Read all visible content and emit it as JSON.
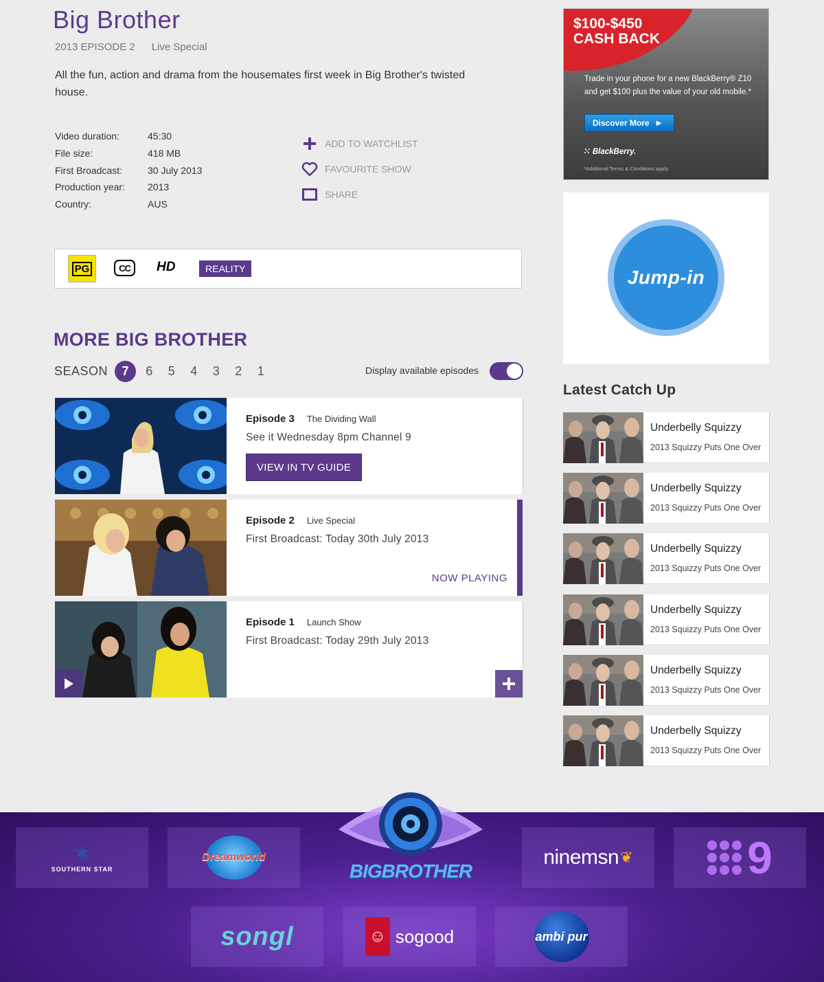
{
  "show": {
    "title": "Big Brother",
    "episode_label": "2013 EPISODE 2",
    "episode_type": "Live Special",
    "description": "All the fun, action and drama from the housemates first week in Big Brother's twisted house."
  },
  "details": [
    {
      "label": "Video duration:",
      "value": "45:30"
    },
    {
      "label": "File size:",
      "value": "418 MB"
    },
    {
      "label": "First Broadcast:",
      "value": "30 July 2013"
    },
    {
      "label": "Production year:",
      "value": "2013"
    },
    {
      "label": "Country:",
      "value": "AUS"
    }
  ],
  "actions": {
    "watchlist": "ADD TO WATCHLIST",
    "favourite": "FAVOURITE SHOW",
    "share": "SHARE"
  },
  "badges": {
    "rating": "PG",
    "cc": "CC",
    "hd": "HD",
    "genre": "REALITY"
  },
  "more": {
    "title": "MORE BIG BROTHER",
    "season_label": "SEASON",
    "seasons": [
      "7",
      "6",
      "5",
      "4",
      "3",
      "2",
      "1"
    ],
    "active_season": "7",
    "toggle_label": "Display available episodes",
    "toggle_on": true
  },
  "episodes": [
    {
      "number": "Episode 3",
      "name": "The Dividing Wall",
      "sub": "See it Wednesday 8pm Channel 9",
      "button": "VIEW IN TV GUIDE"
    },
    {
      "number": "Episode 2",
      "name": "Live Special",
      "sub": "First Broadcast: Today 30th July 2013",
      "status": "NOW PLAYING"
    },
    {
      "number": "Episode 1",
      "name": "Launch Show",
      "sub": "First Broadcast: Today 29th July 2013"
    }
  ],
  "ad": {
    "headline_1": "$100-$450",
    "headline_2": "CASH BACK",
    "text": "Trade in your phone for a new BlackBerry® Z10 and get $100 plus the value of your old mobile.*",
    "button": "Discover More",
    "brand": "BlackBerry.",
    "terms": "*Additional Terms & Conditions apply."
  },
  "jump_in": {
    "label": "Jump-in"
  },
  "catchup": {
    "title": "Latest Catch Up",
    "items": [
      {
        "name": "Underbelly Squizzy",
        "episode": "2013 Squizzy Puts One Over"
      },
      {
        "name": "Underbelly Squizzy",
        "episode": "2013 Squizzy Puts One Over"
      },
      {
        "name": "Underbelly Squizzy",
        "episode": "2013 Squizzy Puts One Over"
      },
      {
        "name": "Underbelly Squizzy",
        "episode": "2013 Squizzy Puts One Over"
      },
      {
        "name": "Underbelly Squizzy",
        "episode": "2013 Squizzy Puts One Over"
      },
      {
        "name": "Underbelly Squizzy",
        "episode": "2013 Squizzy Puts One Over"
      }
    ]
  },
  "footer": {
    "center_logo": "BIGBROTHER",
    "sponsors": [
      {
        "name": "SOUTHERN STAR",
        "icon": "southern-star-logo"
      },
      {
        "name": "Dreamworld",
        "icon": "dreamworld-logo"
      },
      {
        "name": "ninemsn",
        "icon": "ninemsn-logo"
      },
      {
        "name": "9",
        "icon": "channel-nine-logo"
      },
      {
        "name": "songl",
        "icon": "songl-logo"
      },
      {
        "name": "sogood",
        "icon": "kfc-sogood-logo"
      },
      {
        "name": "ambi pur",
        "icon": "ambipur-logo"
      }
    ]
  },
  "colors": {
    "brand_purple": "#5b3a8c",
    "background": "#ececec",
    "ad_red": "#d8232a",
    "jump_blue": "#2e8ede"
  }
}
